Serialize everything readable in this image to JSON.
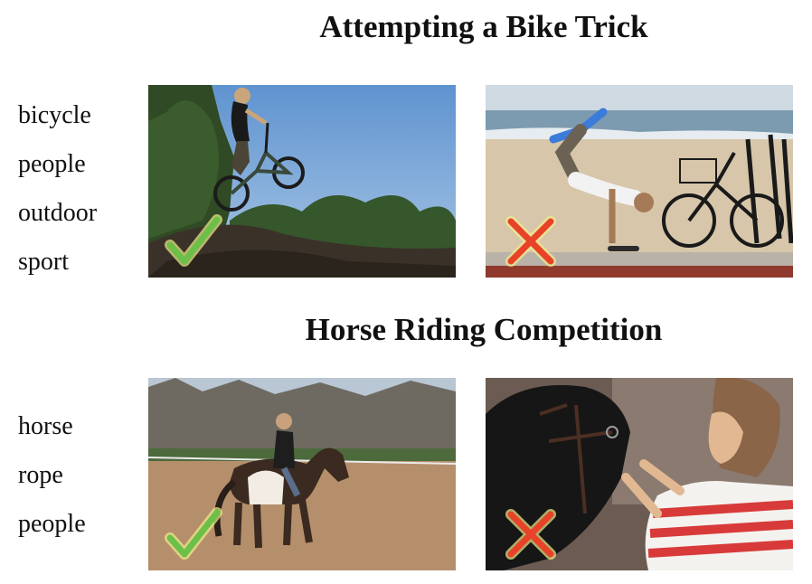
{
  "sections": [
    {
      "title": "Attempting a Bike Trick",
      "tags": [
        "bicycle",
        "people",
        "outdoor",
        "sport"
      ],
      "images": [
        {
          "subject": "rider jumping a dirt bike over a hill",
          "mark": "check-icon"
        },
        {
          "subject": "breakdancer on skateboard beside parked bicycles at a beach",
          "mark": "cross-icon"
        }
      ]
    },
    {
      "title": "Horse Riding Competition",
      "tags": [
        "horse",
        "rope",
        "people"
      ],
      "images": [
        {
          "subject": "rider on a pinto horse in a dirt arena",
          "mark": "check-icon"
        },
        {
          "subject": "woman fastening a bridle on a dark horse",
          "mark": "cross-icon"
        }
      ]
    }
  ],
  "colors": {
    "check": "#6cc04a",
    "cross": "#e8432a",
    "glow": "#f4f08a"
  }
}
